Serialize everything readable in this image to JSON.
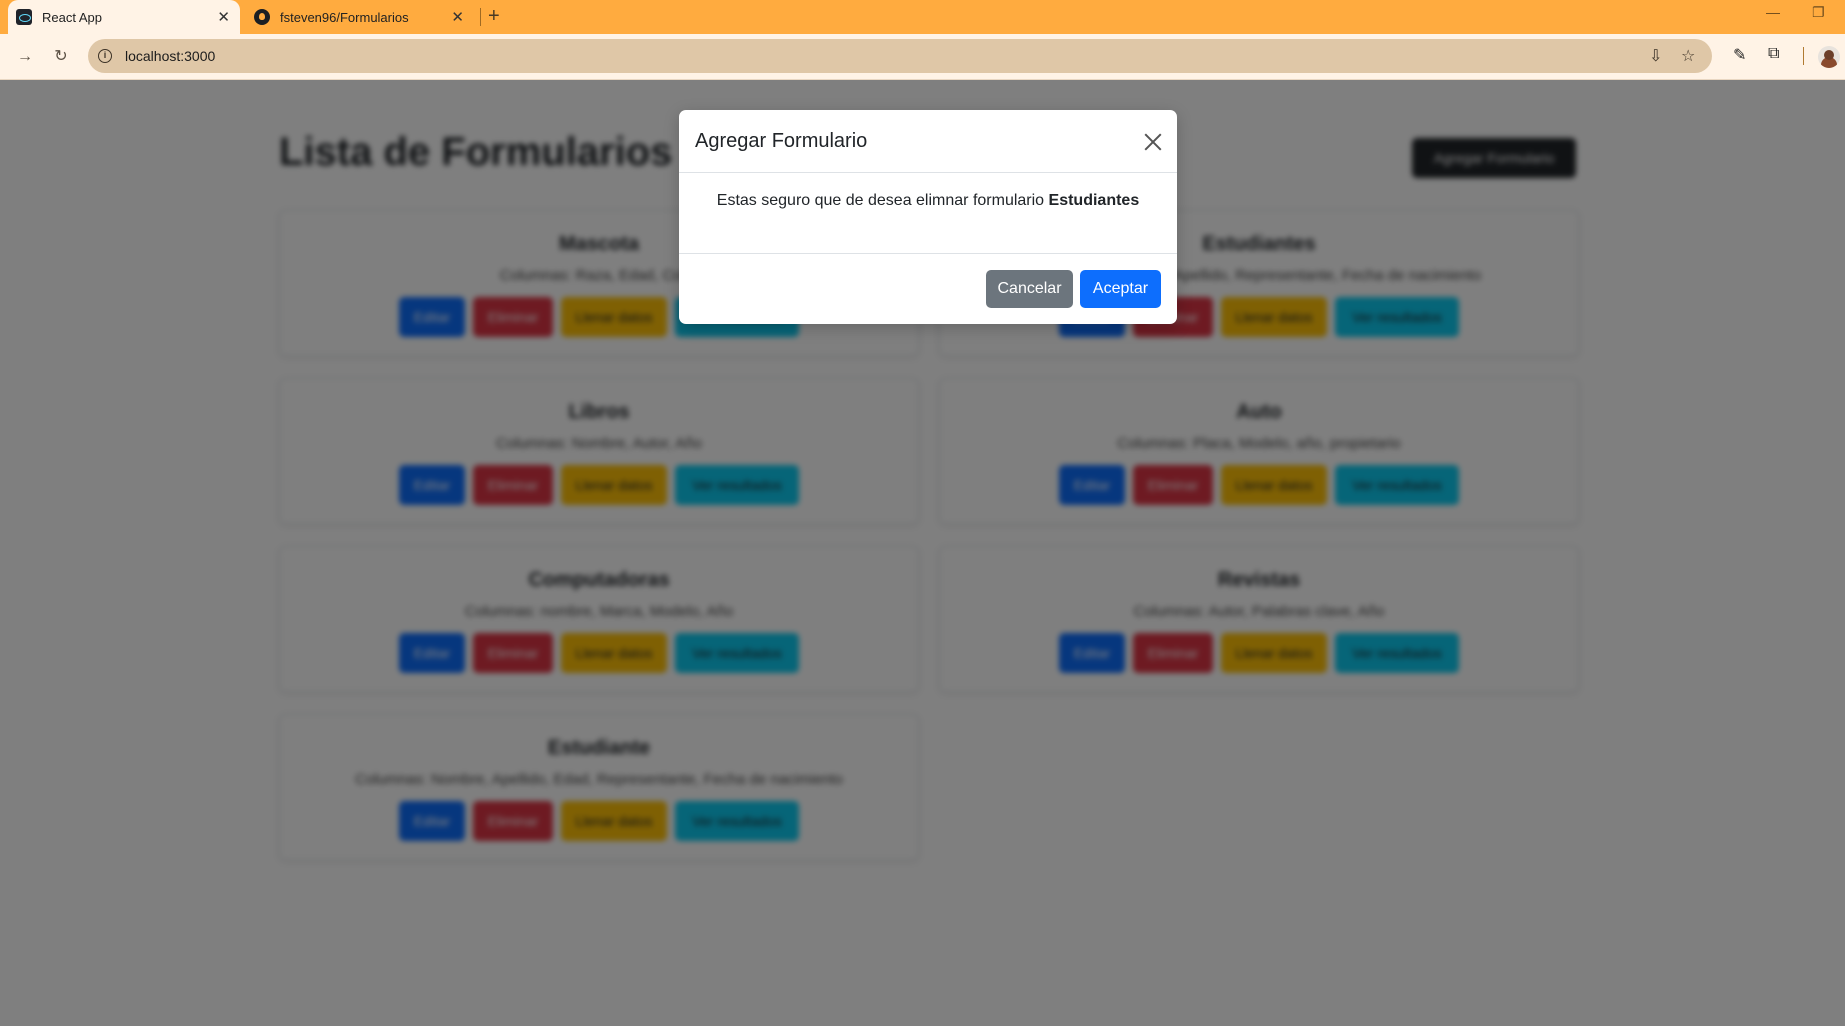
{
  "browser": {
    "tabs": [
      {
        "title": "React App",
        "active": true,
        "icon": "react-icon"
      },
      {
        "title": "fsteven96/Formularios",
        "active": false,
        "icon": "github-icon"
      }
    ],
    "url": "localhost:3000"
  },
  "page": {
    "title": "Lista de Formularios",
    "add_button": "Agregar Formulario",
    "cards": [
      {
        "title": "Mascota",
        "columns": "Columnas: Raza, Edad, Color",
        "actions": [
          "Editar",
          "Eliminar",
          "Llenar datos",
          "Ver resultados"
        ]
      },
      {
        "title": "Estudiantes",
        "columns": "Columnas: Nombre, Apellido, Representante, Fecha de nacimiento",
        "actions": [
          "Editar",
          "Eliminar",
          "Llenar datos",
          "Ver resultados"
        ]
      },
      {
        "title": "Libros",
        "columns": "Columnas: Nombre, Autor, Año",
        "actions": [
          "Editar",
          "Eliminar",
          "Llenar datos",
          "Ver resultados"
        ]
      },
      {
        "title": "Auto",
        "columns": "Columnas: Placa, Modelo, año, propietario",
        "actions": [
          "Editar",
          "Eliminar",
          "Llenar datos",
          "Ver resultados"
        ]
      },
      {
        "title": "Computadoras",
        "columns": "Columnas: nombre, Marca, Modelo, Año",
        "actions": [
          "Editar",
          "Eliminar",
          "Llenar datos",
          "Ver resultados"
        ]
      },
      {
        "title": "Revistas",
        "columns": "Columnas: Autor, Palabras clave, Año",
        "actions": [
          "Editar",
          "Eliminar",
          "Llenar datos",
          "Ver resultados"
        ]
      },
      {
        "title": "Estudiante",
        "columns": "Columnas: Nombre, Apellido, Edad, Representante, Fecha de nacimiento",
        "actions": [
          "Editar",
          "Eliminar",
          "Llenar datos",
          "Ver resultados"
        ]
      }
    ]
  },
  "modal": {
    "title": "Agregar Formulario",
    "message": "Estas seguro que de desea elimnar formulario",
    "form_name": "Estudiantes",
    "cancel": "Cancelar",
    "accept": "Aceptar"
  },
  "colors": {
    "tabbar": "#ffab3f",
    "primary": "#0d6efd",
    "secondary": "#6c757d",
    "danger": "#dc3545",
    "warning": "#ffc107",
    "info": "#0dcaf0"
  }
}
